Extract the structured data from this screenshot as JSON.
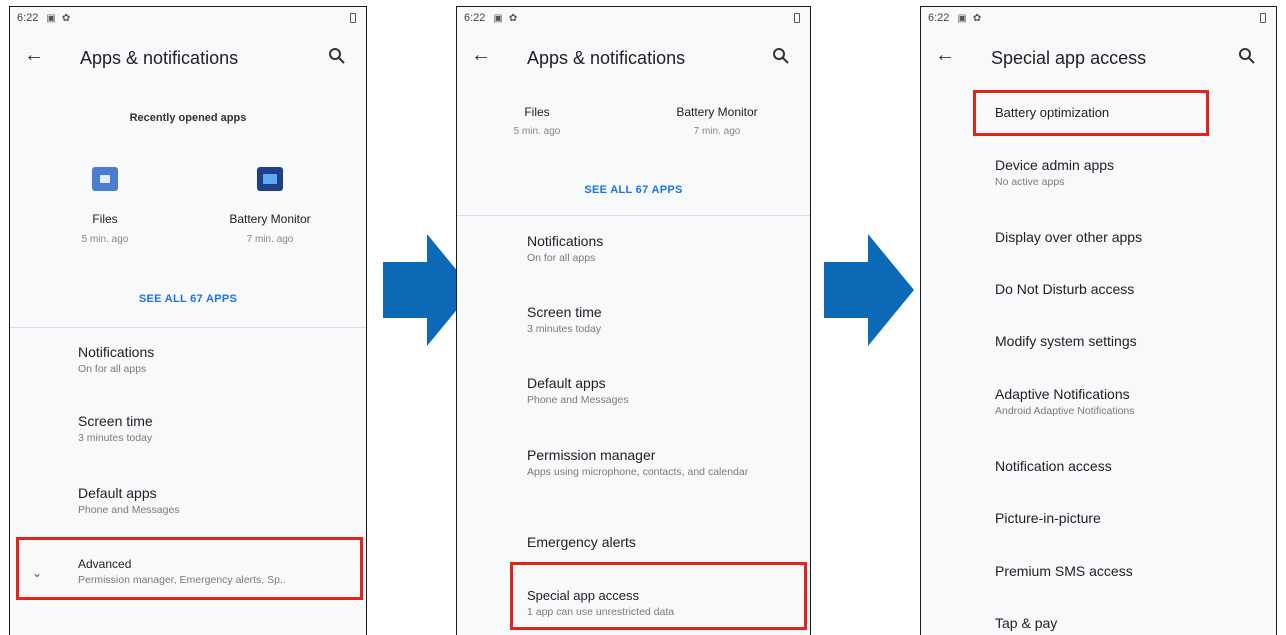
{
  "status": {
    "time": "6:22"
  },
  "colors": {
    "accent": "#1a73e8",
    "highlight": "#e1251b",
    "arrow": "#0b69b5"
  },
  "icons": {
    "back": "arrow-left-icon",
    "search": "search-icon",
    "expand": "chevron-down-icon",
    "step": "right-arrow-icon"
  },
  "screen1": {
    "title": "Apps & notifications",
    "recent_header": "Recently opened apps",
    "apps": [
      {
        "name": "Files",
        "time": "5 min. ago"
      },
      {
        "name": "Battery Monitor",
        "time": "7 min. ago"
      }
    ],
    "see_all": "SEE ALL 67 APPS",
    "items": [
      {
        "title": "Notifications",
        "subtitle": "On for all apps"
      },
      {
        "title": "Screen time",
        "subtitle": "3 minutes today"
      },
      {
        "title": "Default apps",
        "subtitle": "Phone and Messages"
      },
      {
        "title": "Advanced",
        "subtitle": "Permission manager, Emergency alerts, Sp.."
      }
    ]
  },
  "screen2": {
    "title": "Apps & notifications",
    "apps": [
      {
        "name": "Files",
        "time": "5 min. ago"
      },
      {
        "name": "Battery Monitor",
        "time": "7 min. ago"
      }
    ],
    "see_all": "SEE ALL 67 APPS",
    "items": [
      {
        "title": "Notifications",
        "subtitle": "On for all apps"
      },
      {
        "title": "Screen time",
        "subtitle": "3 minutes today"
      },
      {
        "title": "Default apps",
        "subtitle": "Phone and Messages"
      },
      {
        "title": "Permission manager",
        "subtitle": "Apps using microphone, contacts, and calendar"
      },
      {
        "title": "Emergency alerts",
        "subtitle": ""
      },
      {
        "title": "Special app access",
        "subtitle": "1 app can use unrestricted data"
      }
    ]
  },
  "screen3": {
    "title": "Special app access",
    "items": [
      {
        "title": "Battery optimization",
        "subtitle": ""
      },
      {
        "title": "Device admin apps",
        "subtitle": "No active apps"
      },
      {
        "title": "Display over other apps",
        "subtitle": ""
      },
      {
        "title": "Do Not Disturb access",
        "subtitle": ""
      },
      {
        "title": "Modify system settings",
        "subtitle": ""
      },
      {
        "title": "Adaptive Notifications",
        "subtitle": "Android Adaptive Notifications"
      },
      {
        "title": "Notification access",
        "subtitle": ""
      },
      {
        "title": "Picture-in-picture",
        "subtitle": ""
      },
      {
        "title": "Premium SMS access",
        "subtitle": ""
      },
      {
        "title": "Tap & pay",
        "subtitle": ""
      }
    ]
  }
}
